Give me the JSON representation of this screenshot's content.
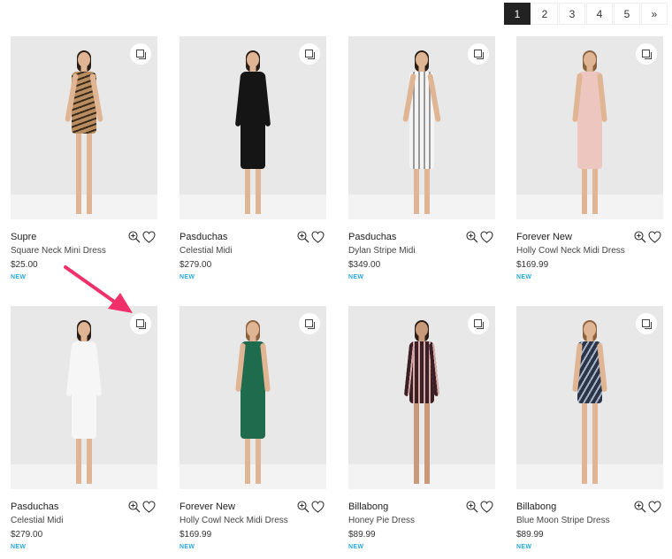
{
  "pagination": {
    "pages": [
      "1",
      "2",
      "3",
      "4",
      "5"
    ],
    "active": "1",
    "next_label": "»"
  },
  "badge_color": "#2aa8d8",
  "annotation": {
    "type": "arrow",
    "color": "#f0306a",
    "points_to": "quick-view-button of product 5"
  },
  "products": [
    {
      "brand": "Supre",
      "name": "Square Neck Mini Dress",
      "price": "$25.00",
      "badge": "NEW",
      "dress": "tiger-stripe",
      "dress_color": "#b98d60"
    },
    {
      "brand": "Pasduchas",
      "name": "Celestial Midi",
      "price": "$279.00",
      "badge": "NEW",
      "dress": "black",
      "dress_color": "#151515"
    },
    {
      "brand": "Pasduchas",
      "name": "Dylan Stripe Midi",
      "price": "$349.00",
      "badge": "NEW",
      "dress": "white-stripe",
      "dress_color": "#f4f4f4"
    },
    {
      "brand": "Forever New",
      "name": "Holly Cowl Neck Midi Dress",
      "price": "$169.99",
      "badge": "NEW",
      "dress": "blush",
      "dress_color": "#eec6c0"
    },
    {
      "brand": "Pasduchas",
      "name": "Celestial Midi",
      "price": "$279.00",
      "badge": "NEW",
      "dress": "white",
      "dress_color": "#f6f6f6"
    },
    {
      "brand": "Forever New",
      "name": "Holly Cowl Neck Midi Dress",
      "price": "$169.99",
      "badge": "NEW",
      "dress": "green",
      "dress_color": "#1f6b4e"
    },
    {
      "brand": "Billabong",
      "name": "Honey Pie Dress",
      "price": "$89.99",
      "badge": "NEW",
      "dress": "maroon-stripe",
      "dress_color": "#3a1f24"
    },
    {
      "brand": "Billabong",
      "name": "Blue Moon Stripe Dress",
      "price": "$89.99",
      "badge": "NEW",
      "dress": "navy-stripe",
      "dress_color": "#2c3447"
    }
  ]
}
